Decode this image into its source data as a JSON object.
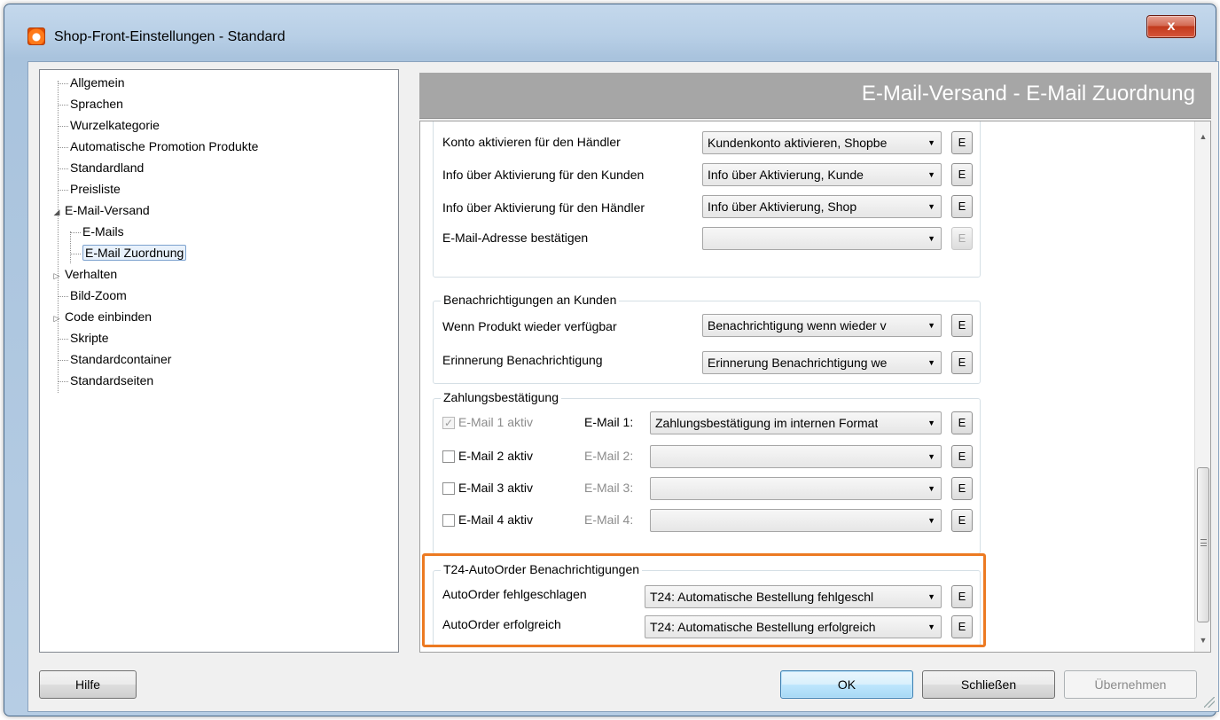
{
  "window": {
    "title": "Shop-Front-Einstellungen - Standard",
    "close_label": "x"
  },
  "tree": {
    "items": [
      {
        "label": "Allgemein"
      },
      {
        "label": "Sprachen"
      },
      {
        "label": "Wurzelkategorie"
      },
      {
        "label": "Automatische Promotion Produkte"
      },
      {
        "label": "Standardland"
      },
      {
        "label": "Preisliste"
      },
      {
        "label": "E-Mail-Versand",
        "expanded": true
      },
      {
        "label": "E-Mails"
      },
      {
        "label": "E-Mail Zuordnung",
        "selected": true
      },
      {
        "label": "Verhalten",
        "collapsed": true
      },
      {
        "label": "Bild-Zoom"
      },
      {
        "label": "Code einbinden",
        "collapsed": true
      },
      {
        "label": "Skripte"
      },
      {
        "label": "Standardcontainer"
      },
      {
        "label": "Standardseiten"
      }
    ]
  },
  "header": {
    "title": "E-Mail-Versand - E-Mail Zuordnung"
  },
  "account": {
    "rows": [
      {
        "label": "Konto aktivieren für den Händler",
        "value": "Kundenkonto aktivieren, Shopbe",
        "button": "E"
      },
      {
        "label": "Info über Aktivierung für den Kunden",
        "value": "Info über Aktivierung, Kunde",
        "button": "E"
      },
      {
        "label": "Info über Aktivierung für den Händler",
        "value": "Info über Aktivierung, Shop",
        "button": "E"
      },
      {
        "label": "E-Mail-Adresse bestätigen",
        "value": "",
        "button": "E"
      }
    ]
  },
  "customer_notifications": {
    "title": "Benachrichtigungen an Kunden",
    "rows": [
      {
        "label": "Wenn Produkt wieder verfügbar",
        "value": "Benachrichtigung wenn wieder v",
        "button": "E"
      },
      {
        "label": "Erinnerung Benachrichtigung",
        "value": "Erinnerung Benachrichtigung we",
        "button": "E"
      }
    ]
  },
  "payment": {
    "title": "Zahlungsbestätigung",
    "rows": [
      {
        "check_label": "E-Mail 1 aktiv",
        "checked": true,
        "email_label": "E-Mail 1:",
        "value": "Zahlungsbestätigung im internen Format",
        "button": "E"
      },
      {
        "check_label": "E-Mail 2 aktiv",
        "checked": false,
        "email_label": "E-Mail 2:",
        "value": "",
        "button": "E"
      },
      {
        "check_label": "E-Mail 3 aktiv",
        "checked": false,
        "email_label": "E-Mail 3:",
        "value": "",
        "button": "E"
      },
      {
        "check_label": "E-Mail 4 aktiv",
        "checked": false,
        "email_label": "E-Mail 4:",
        "value": "",
        "button": "E"
      }
    ]
  },
  "autoorder": {
    "title": "T24-AutoOrder Benachrichtigungen",
    "rows": [
      {
        "label": "AutoOrder fehlgeschlagen",
        "value": "T24: Automatische Bestellung fehlgeschl",
        "button": "E"
      },
      {
        "label": "AutoOrder erfolgreich",
        "value": "T24: Automatische Bestellung erfolgreich",
        "button": "E"
      }
    ]
  },
  "footer": {
    "help_label": "Hilfe",
    "ok_label": "OK",
    "close_label": "Schließen",
    "apply_label": "Übernehmen"
  },
  "colors": {
    "highlight": "#ec7a22",
    "header_bg": "#a6a6a6"
  }
}
